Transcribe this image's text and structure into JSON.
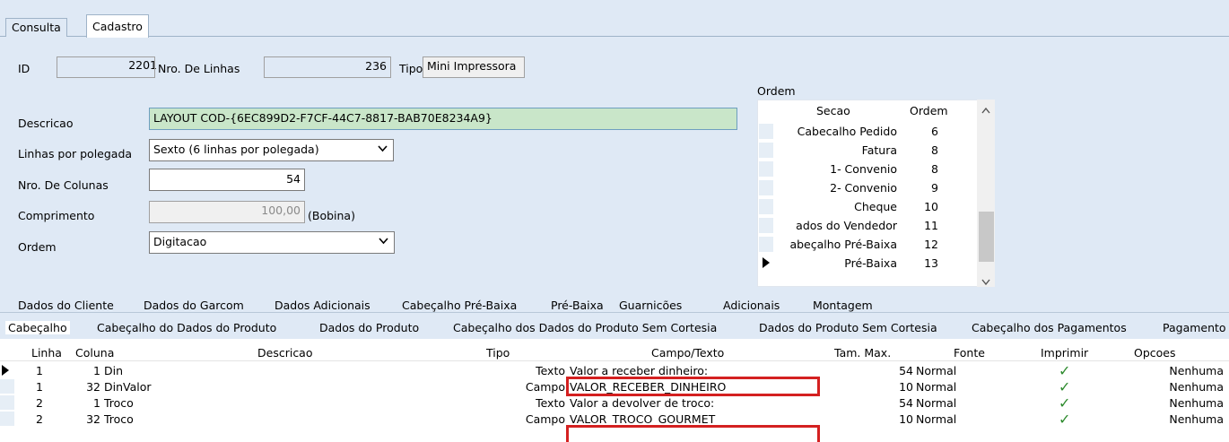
{
  "top_tabs": [
    "Consulta",
    "Cadastro"
  ],
  "form": {
    "id_label": "ID",
    "id_value": "2201",
    "nro_linhas_label": "Nro. De Linhas",
    "nro_linhas_value": "236",
    "tipo_label": "Tipo",
    "tipo_value": "Mini Impressora",
    "descricao_label": "Descricao",
    "descricao_value": "LAYOUT  COD-{6EC899D2-F7CF-44C7-8817-BAB70E8234A9}",
    "linhas_polegada_label": "Linhas por polegada",
    "linhas_polegada_value": "Sexto  (6 linhas por polegada)",
    "nro_colunas_label": "Nro. De Colunas",
    "nro_colunas_value": "54",
    "comprimento_label": "Comprimento",
    "comprimento_value": "100,00",
    "comprimento_suffix": "(Bobina)",
    "ordem_label": "Ordem",
    "ordem_value": "Digitacao"
  },
  "ordem_panel": {
    "title": "Ordem",
    "col_secao": "Secao",
    "col_ordem": "Ordem",
    "rows": [
      {
        "secao": "Cabecalho Pedido",
        "ordem": "6"
      },
      {
        "secao": "Fatura",
        "ordem": "8"
      },
      {
        "secao": "1- Convenio",
        "ordem": "8"
      },
      {
        "secao": "2- Convenio",
        "ordem": "9"
      },
      {
        "secao": "Cheque",
        "ordem": "10"
      },
      {
        "secao": "ados do Vendedor",
        "ordem": "11"
      },
      {
        "secao": "abeçalho Pré-Baixa",
        "ordem": "12"
      },
      {
        "secao": "Pré-Baixa",
        "ordem": "13"
      }
    ]
  },
  "section_tabs_row1": [
    "Dados do Cliente",
    "Dados do Garcom",
    "Dados Adicionais",
    "Cabeçalho Pré-Baixa",
    "Pré-Baixa",
    "Guarnicões",
    "Adicionais",
    "Montagem"
  ],
  "section_tabs_row2": [
    "Cabeçalho",
    "Cabeçalho do Dados do Produto",
    "Dados do Produto",
    "Cabeçalho dos Dados do Produto Sem Cortesia",
    "Dados do Produto Sem Cortesia",
    "Cabeçalho dos Pagamentos",
    "Pagamento"
  ],
  "grid": {
    "headers": [
      "Linha",
      "Coluna",
      "Descricao",
      "Tipo",
      "Campo/Texto",
      "Tam. Max.",
      "Fonte",
      "Imprimir",
      "Opcoes"
    ],
    "rows": [
      {
        "linha": "1",
        "coluna": "1",
        "descricao": "Din",
        "tipo": "Texto",
        "campo": "Valor a receber dinheiro:",
        "tam": "54",
        "fonte": "Normal",
        "opcoes": "Nenhuma"
      },
      {
        "linha": "1",
        "coluna": "32",
        "descricao": "DinValor",
        "tipo": "Campo",
        "campo": "VALOR_RECEBER_DINHEIRO",
        "tam": "10",
        "fonte": "Normal",
        "opcoes": "Nenhuma"
      },
      {
        "linha": "2",
        "coluna": "1",
        "descricao": "Troco",
        "tipo": "Texto",
        "campo": "Valor a devolver de troco:",
        "tam": "54",
        "fonte": "Normal",
        "opcoes": "Nenhuma"
      },
      {
        "linha": "2",
        "coluna": "32",
        "descricao": "Troco",
        "tipo": "Campo",
        "campo": "VALOR_TROCO_GOURMET",
        "tam": "10",
        "fonte": "Normal",
        "opcoes": "Nenhuma"
      }
    ]
  },
  "colors": {
    "header_bg": "#dfe9f5",
    "descricao_bg": "#c9e6c9",
    "highlight_red": "#d42020",
    "check_green": "#2e8b2e"
  }
}
